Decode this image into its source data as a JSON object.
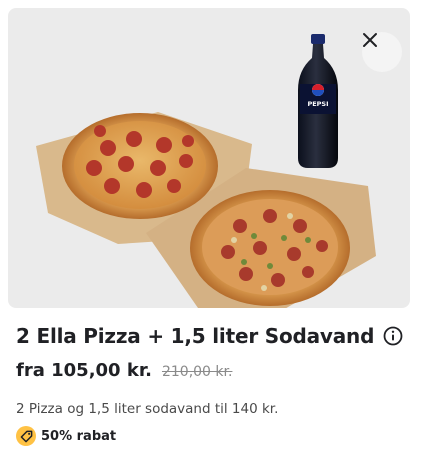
{
  "product": {
    "image_alt": "2 pizzas and a 1.5 liter Pepsi bottle",
    "bottle_brand": "PEPSI",
    "title": "2 Ella Pizza + 1,5 liter Sodavand",
    "price": "fra 105,00 kr.",
    "old_price": "210,00 kr.",
    "description": "2 Pizza og 1,5 liter sodavand til 140 kr.",
    "badge": "50% rabat"
  },
  "icons": {
    "close": "close-icon",
    "info": "info-icon",
    "discount": "tag-icon"
  },
  "colors": {
    "badge": "#ffc244",
    "text": "#202125",
    "muted": "#8a8a8a",
    "image_bg": "#ebebeb"
  }
}
